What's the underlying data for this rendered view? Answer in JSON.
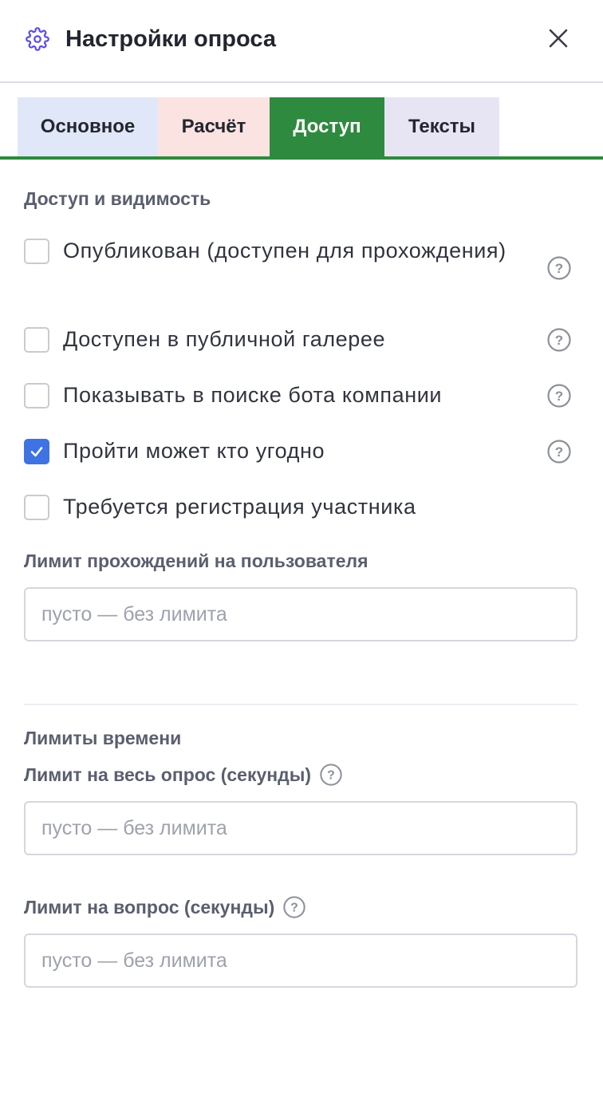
{
  "header": {
    "title": "Настройки опроса",
    "icon": "gear-icon",
    "close_icon": "close-icon"
  },
  "tabs": [
    {
      "label": "Основное",
      "active": false,
      "color": "#e0e7f8"
    },
    {
      "label": "Расчёт",
      "active": false,
      "color": "#fbe3e1"
    },
    {
      "label": "Доступ",
      "active": true,
      "color": "#2e8a3e"
    },
    {
      "label": "Тексты",
      "active": false,
      "color": "#e7e4f4"
    }
  ],
  "access": {
    "section_title": "Доступ и видимость",
    "checkboxes": [
      {
        "label": "Опубликован (доступен для прохождения)",
        "checked": false,
        "help": true
      },
      {
        "label": "Доступен в публичной галерее",
        "checked": false,
        "help": true
      },
      {
        "label": "Показывать в поиске бота компании",
        "checked": false,
        "help": true
      },
      {
        "label": "Пройти может кто угодно",
        "checked": true,
        "help": true
      },
      {
        "label": "Требуется регистрация участника",
        "checked": false,
        "help": false
      }
    ],
    "attempt_limit": {
      "label": "Лимит прохождений на пользователя",
      "value": "",
      "placeholder": "пусто — без лимита"
    }
  },
  "time_limits": {
    "section_title": "Лимиты времени",
    "total": {
      "label": "Лимит на весь опрос (секунды)",
      "value": "",
      "placeholder": "пусто — без лимита"
    },
    "per_question": {
      "label": "Лимит на вопрос (секунды)",
      "value": "",
      "placeholder": "пусто — без лимита"
    }
  },
  "colors": {
    "accent_green": "#2e8a3e",
    "checkbox_checked": "#3f73e3",
    "gear_icon": "#5b4fe0"
  }
}
